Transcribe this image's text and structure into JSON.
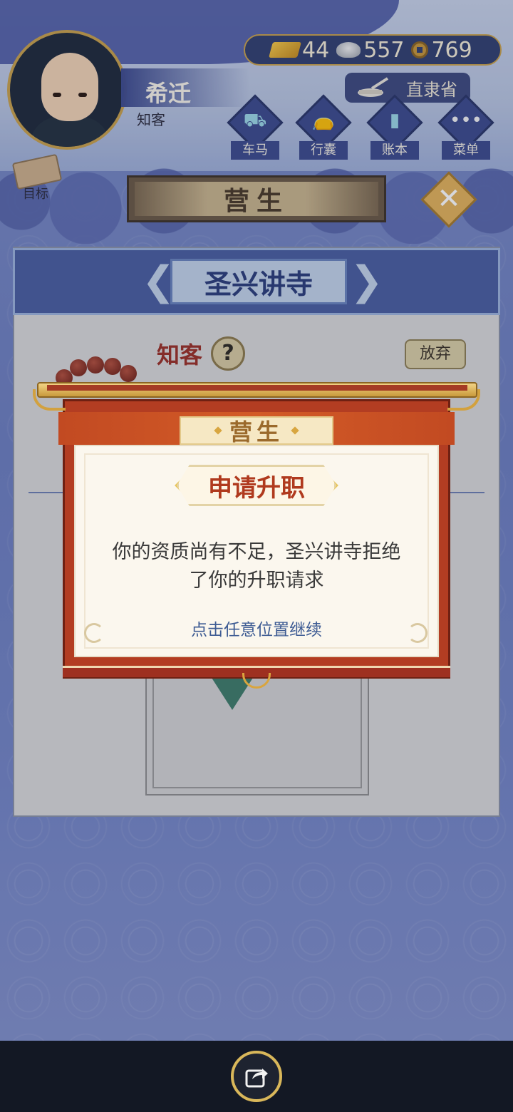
{
  "player": {
    "name": "希迁",
    "title": "知客"
  },
  "currency": {
    "gold": "44",
    "silver": "557",
    "coins": "769"
  },
  "region": {
    "label": "直隶省",
    "icon": "mortar-pestle-icon"
  },
  "nav": [
    {
      "label": "车马",
      "icon": "carriage-icon"
    },
    {
      "label": "行囊",
      "icon": "bag-icon"
    },
    {
      "label": "账本",
      "icon": "ledger-icon"
    },
    {
      "label": "菜单",
      "icon": "menu-dots-icon"
    }
  ],
  "goal": {
    "label": "目标",
    "icon": "scroll-icon"
  },
  "section": {
    "title": "营生",
    "close_icon": "close-icon"
  },
  "panel": {
    "temple": "圣兴讲寺",
    "rank": "知客",
    "help_label": "?",
    "give_up_label": "放弃"
  },
  "dialog": {
    "banner": "营生",
    "heading": "申请升职",
    "message_line1": "你的资质尚有不足，圣兴讲寺拒绝",
    "message_line2": "了你的升职请求",
    "continue_hint": "点击任意位置继续"
  },
  "colors": {
    "accent_gold": "#c9a24b",
    "dialog_red": "#b33d22",
    "heading_red": "#b03a1e",
    "hint_blue": "#3d5b93"
  },
  "bottom": {
    "share_icon": "share-icon"
  }
}
